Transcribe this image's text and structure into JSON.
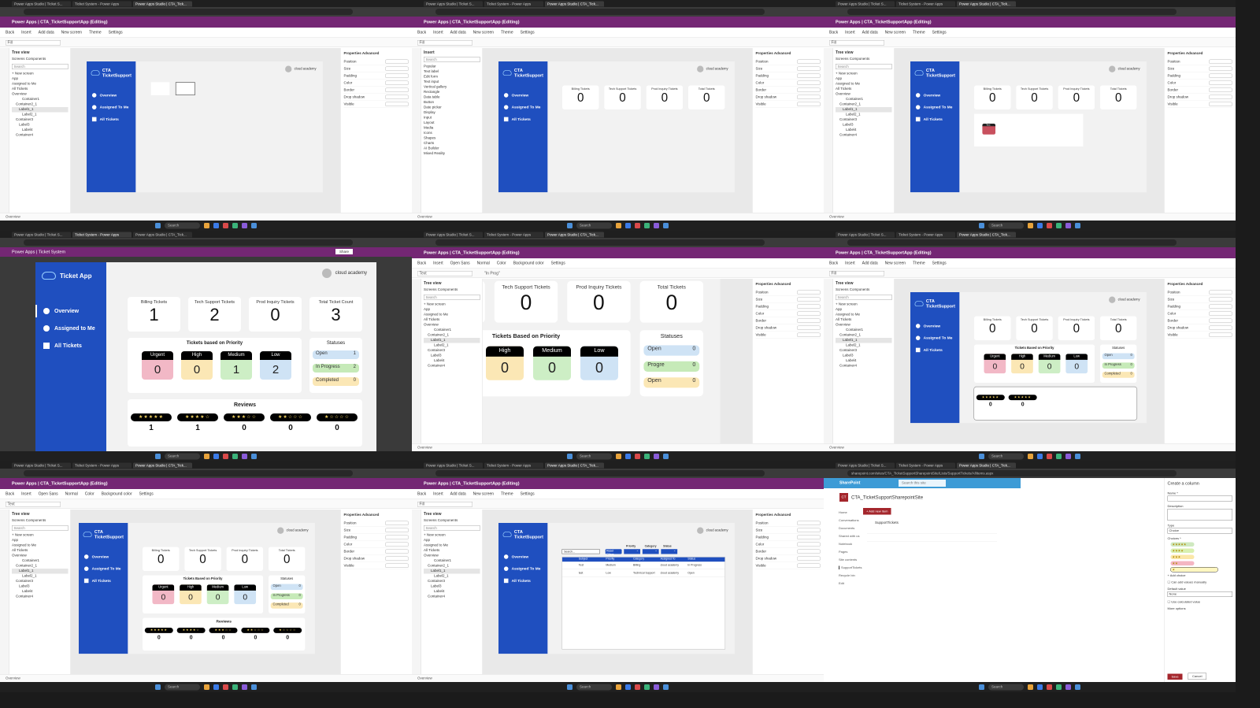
{
  "browser": {
    "tabs": [
      "Power Apps Studio | Ticket S...",
      "Ticket System - Power Apps",
      "Power Apps Studio | CTA_Tick..."
    ],
    "sharepoint_url": "sharepoint.com/sites/CTA_TicketSupportSharepointSite/Lists/SupportTickets/AllItems.aspx"
  },
  "studio": {
    "title": "Power Apps | CTA_TicketSupportApp (Editing)",
    "toolbar": [
      "Back",
      "Insert",
      "Add data",
      "New screen",
      "Theme",
      "Settings"
    ],
    "toolbar_text": [
      "Back",
      "Insert",
      "Open Sans",
      "Normal",
      "Color",
      "Background color",
      "Settings"
    ],
    "tree_title": "Tree view",
    "tree_tabs": [
      "Screens",
      "Components"
    ],
    "search_placeholder": "Search",
    "tree_items": [
      "+ New screen",
      "App",
      "Assigned to Me",
      "All Tickets",
      "Overview",
      "Container1",
      "Container2_1",
      "Label1_1",
      "Label2_1",
      "Container3",
      "Label3",
      "Label4",
      "Container4"
    ],
    "props_tabs": [
      "Properties",
      "Advanced"
    ],
    "props_rows": [
      "Position",
      "Size",
      "Padding",
      "Color",
      "Border",
      "Drop shadow",
      "Visible"
    ],
    "status_screen": "Overview",
    "taskbar_search": "Search"
  },
  "insert_pane": {
    "title": "Insert",
    "items": [
      "Popular",
      "Text label",
      "Edit form",
      "Text input",
      "Vertical gallery",
      "Rectangle",
      "Data table",
      "Button",
      "Date picker",
      "Display",
      "Input",
      "Layout",
      "Media",
      "Icons",
      "Shapes",
      "Charts",
      "AI Builder",
      "Mixed Reality"
    ]
  },
  "play": {
    "title": "Power Apps | Ticket System",
    "share": "Share"
  },
  "app": {
    "brand": "CTA TicketSupport",
    "brand_play": "Ticket App",
    "nav": [
      "Overview",
      "Assigned To Me",
      "All Tickets"
    ],
    "nav_play": [
      "Overview",
      "Assigned to Me",
      "All Tickets"
    ],
    "user": "cloud academy",
    "cards": [
      "Billing Tickets",
      "Tech Support Tickets",
      "Prod Inquiry Tickets",
      "Total Tickets"
    ],
    "total_play": "Total Ticket Count",
    "priority_title": "Tickets Based on Priority",
    "priority_title_play": "Tickets based on Priority",
    "priorities": [
      "Urgent",
      "High",
      "Medium",
      "Low"
    ],
    "priority_colors": [
      "#f2b8c6",
      "#fbe7b5",
      "#cdeec5",
      "#cfe3f5"
    ],
    "statuses_title": "Statuses",
    "statuses": [
      "Open",
      "In Progress",
      "Completed"
    ],
    "status_colors": [
      "#cfe3f5",
      "#c6eab8",
      "#fbe7b5"
    ],
    "reviews_title": "Reviews",
    "star_rows": [
      "★★★★★",
      "★★★★☆",
      "★★★☆☆",
      "★★☆☆☆",
      "★☆☆☆☆"
    ],
    "formula_text": "\"In Prog\"",
    "editing_label": "Progre",
    "button_label": "Text"
  },
  "values": {
    "play": {
      "cards": [
        1,
        2,
        0,
        3
      ],
      "priority": [
        0,
        0,
        1,
        2
      ],
      "statuses": [
        1,
        2,
        0
      ],
      "reviews": [
        1,
        1,
        0,
        0,
        0
      ]
    },
    "zero": {
      "cards": [
        0,
        0,
        0,
        0
      ],
      "priority": [
        0,
        0,
        0,
        0
      ],
      "statuses": [
        0,
        0,
        0
      ],
      "reviews": [
        0,
        0,
        0,
        0,
        0
      ]
    }
  },
  "all_tickets": {
    "search_placeholder": "Search...",
    "reset": "Reset Filters",
    "filters": [
      "Priority",
      "Category",
      "Status"
    ],
    "columns": [
      "Subject",
      "Priority",
      "Category",
      "Assigned To",
      "Status"
    ],
    "rows": [
      [
        "Test",
        "Medium",
        "Billing",
        "cloud academy",
        "In Progress"
      ],
      [
        "test",
        "Low",
        "Technical Support",
        "cloud academy",
        "Open"
      ]
    ]
  },
  "sharepoint": {
    "brand": "SharePoint",
    "search": "Search this site",
    "site": "CTA_TicketSupportSharepointSite",
    "nav": [
      "Home",
      "Conversations",
      "Documents",
      "Shared with us",
      "Notebook",
      "Pages",
      "Site contents",
      "SupportTickets",
      "Recycle bin",
      "Edit"
    ],
    "add_item": "+ Add new item",
    "list": "SupportTickets",
    "panel_title": "Create a column",
    "fields": [
      "Name *",
      "Description",
      "Type",
      "Choices *"
    ],
    "type_value": "Choice",
    "choices": [
      "★★★★★",
      "★★★★",
      "★★★",
      "★★",
      "★"
    ],
    "choice_colors": [
      "#cfe9c0",
      "#d8f0b0",
      "#fbe7a8",
      "#f4b6c2",
      "#fff7c0"
    ],
    "add_choice": "+ Add choice",
    "manual": "Can add values manually",
    "default_label": "Default value",
    "default_value": "None",
    "calculated": "Use calculated value",
    "more": "More options",
    "save": "Save",
    "cancel": "Cancel",
    "accent": "#a4262c"
  },
  "colors": {
    "purple": "#742774",
    "app_blue": "#1f4fbf",
    "sharepoint_blue": "#3d9bd6"
  }
}
